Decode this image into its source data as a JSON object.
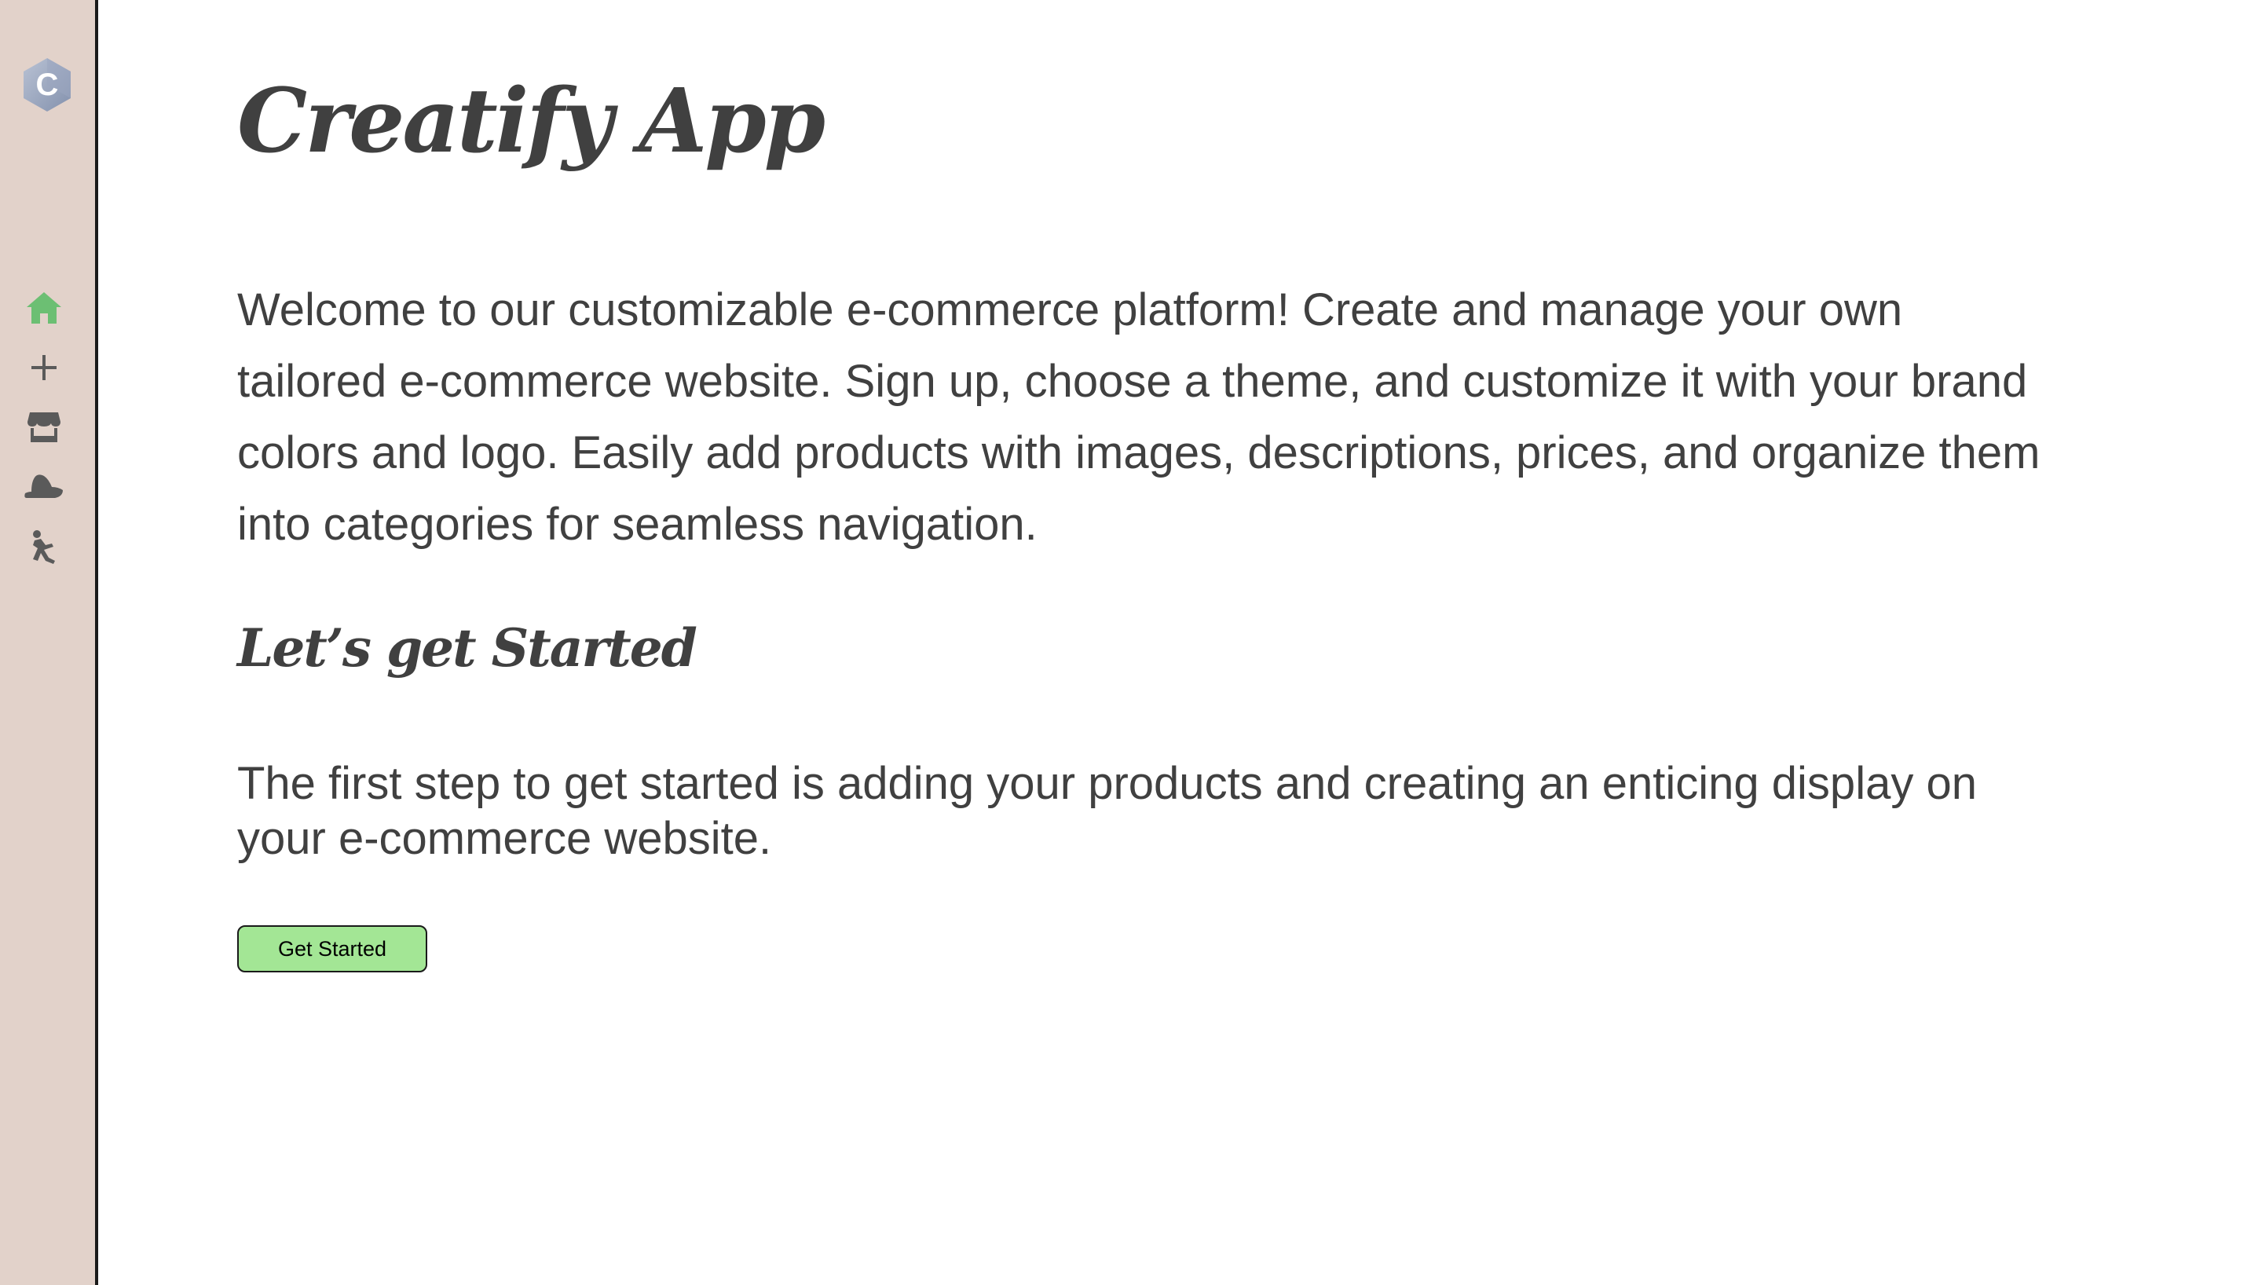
{
  "app": {
    "title": "Creatify App",
    "logo_letter": "C"
  },
  "sidebar": {
    "items": [
      {
        "name": "home",
        "icon": "home-icon",
        "active": true
      },
      {
        "name": "add",
        "icon": "plus-icon",
        "active": false
      },
      {
        "name": "store",
        "icon": "store-icon",
        "active": false
      },
      {
        "name": "hat",
        "icon": "hat-icon",
        "active": false
      },
      {
        "name": "activity",
        "icon": "person-falling-icon",
        "active": false
      }
    ]
  },
  "main": {
    "intro": "Welcome to our customizable e-commerce platform! Create and manage your own tailored e-commerce website. Sign up, choose a theme, and customize it with your brand colors and logo. Easily add products with images, descriptions, prices, and organize them into categories for seamless navigation.",
    "section_title": "Let’s get Started",
    "step_text": "The first step to get started is adding your products and creating an enticing display on your e-commerce website.",
    "cta_label": "Get Started"
  },
  "colors": {
    "sidebar_bg": "#e2d2ca",
    "active_icon": "#6cbf73",
    "inactive_icon": "#5a5a5a",
    "text": "#404040",
    "button_bg": "#a3e695"
  }
}
